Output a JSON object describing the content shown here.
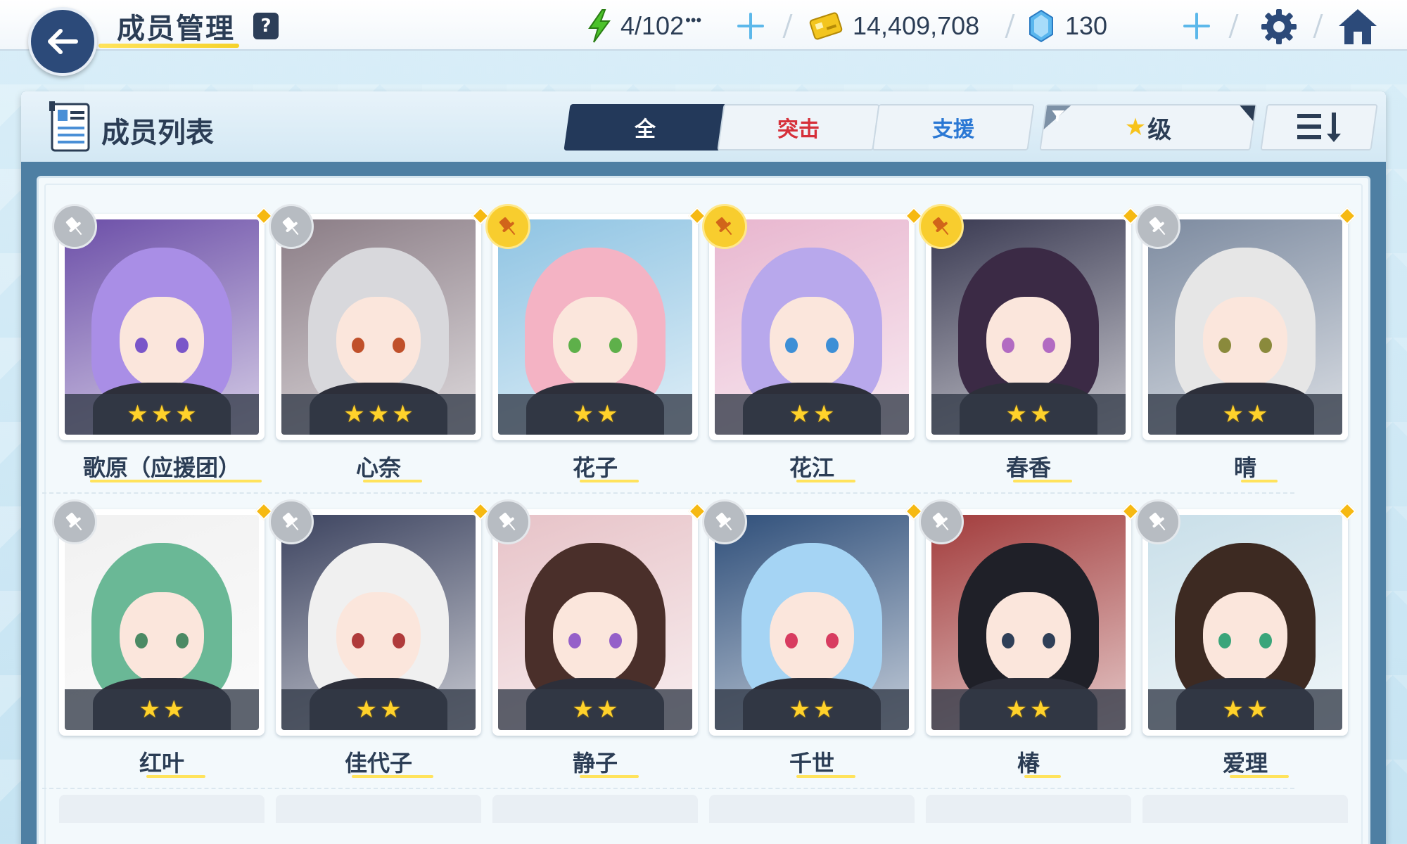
{
  "header": {
    "title": "成员管理",
    "help_label": "?",
    "ap": "4/102",
    "ap_more": "•••",
    "credits": "14,409,708",
    "gems": "130"
  },
  "panel": {
    "title": "成员列表",
    "tabs": [
      {
        "label": "全",
        "active": true,
        "color": "#ffffff"
      },
      {
        "label": "突击",
        "active": false,
        "color": "#d6303a"
      },
      {
        "label": "支援",
        "active": false,
        "color": "#2b78d4"
      }
    ],
    "filter_label": "级",
    "filter_star": "★"
  },
  "students": [
    {
      "name": "歌原（应援团）",
      "stars": 3,
      "pinned": false,
      "hair": "#a98ee6",
      "bg": "#6c4fa8",
      "eye": "#7a56c9"
    },
    {
      "name": "心奈",
      "stars": 3,
      "pinned": false,
      "hair": "#d8d8dc",
      "bg": "#8b7d86",
      "eye": "#c0502a"
    },
    {
      "name": "花子",
      "stars": 2,
      "pinned": true,
      "hair": "#f4b3c4",
      "bg": "#8fc4e3",
      "eye": "#5eb04a"
    },
    {
      "name": "花江",
      "stars": 2,
      "pinned": true,
      "hair": "#b8a8ec",
      "bg": "#e8b6cf",
      "eye": "#3d8fd6"
    },
    {
      "name": "春香",
      "stars": 2,
      "pinned": true,
      "hair": "#3b2a45",
      "bg": "#3a3a52",
      "eye": "#b26bc2"
    },
    {
      "name": "晴",
      "stars": 2,
      "pinned": false,
      "hair": "#e6e6e6",
      "bg": "#7d8ba0",
      "eye": "#8a8a3c"
    },
    {
      "name": "红叶",
      "stars": 2,
      "pinned": false,
      "hair": "#6ab896",
      "bg": "#f1f1f1",
      "eye": "#4b8a64"
    },
    {
      "name": "佳代子",
      "stars": 2,
      "pinned": false,
      "hair": "#f0f0f0",
      "bg": "#3d4460",
      "eye": "#b03b3b"
    },
    {
      "name": "静子",
      "stars": 2,
      "pinned": false,
      "hair": "#4a2f2a",
      "bg": "#e7c3c8",
      "eye": "#9560c9"
    },
    {
      "name": "千世",
      "stars": 2,
      "pinned": false,
      "hair": "#a5d4f4",
      "bg": "#2f4f7a",
      "eye": "#d83c60"
    },
    {
      "name": "椿",
      "stars": 2,
      "pinned": false,
      "hair": "#1f2028",
      "bg": "#a23c3c",
      "eye": "#2f3f57"
    },
    {
      "name": "爱理",
      "stars": 2,
      "pinned": false,
      "hair": "#3d2a22",
      "bg": "#c9dfe9",
      "eye": "#3aa57a"
    }
  ],
  "colors": {
    "accent_yellow": "#ffe35c",
    "navy": "#23395a",
    "plus_blue": "#5cb8ea",
    "ap_green": "#4cc22b"
  },
  "icons": {
    "back": "arrow-left-icon",
    "ap": "lightning-icon",
    "credits": "credit-card-icon",
    "gems": "pyroxene-crystal-icon",
    "settings": "gear-icon",
    "home": "home-icon",
    "pin": "pin-icon",
    "filter": "funnel-icon",
    "sort": "sort-list-icon"
  }
}
